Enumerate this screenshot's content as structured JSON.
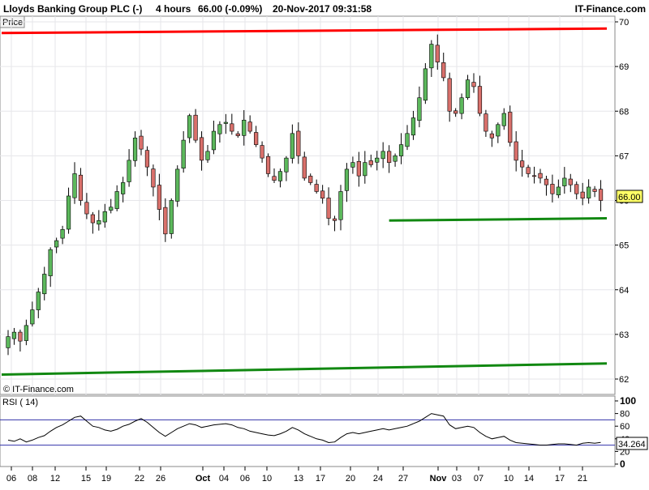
{
  "header": {
    "instrument": "Lloyds Banking Group PLC (-)",
    "timeframe": "4 hours",
    "quote": "66.00 (-0.09%)",
    "datetime": "20-Nov-2017 09:31:58",
    "brand": "IT-Finance.com"
  },
  "price_panel": {
    "label": "Price",
    "watermark": "© IT-Finance.com",
    "last_price_label": "66.00"
  },
  "rsi_panel": {
    "label": "RSI ( 14)",
    "value_label": "34.264"
  },
  "colors": {
    "up_candle": "#5cb85c",
    "down_candle": "#d9706b",
    "resistance_line": "#ff0000",
    "support_line": "#118811",
    "rsi_line": "#000000",
    "rsi_levels": "#3333aa",
    "grid": "#e6e6ea"
  },
  "chart_data": [
    {
      "type": "candlestick",
      "title": "Lloyds Banking Group PLC (-) 4 hours",
      "ylabel": "Price",
      "ylim": [
        62,
        70
      ],
      "y_ticks": [
        "70",
        "69",
        "68",
        "67",
        "66",
        "65",
        "64",
        "63",
        "62"
      ],
      "x_ticks": [
        "06",
        "08",
        "12",
        "15",
        "19",
        "22",
        "26",
        "Oct",
        "04",
        "06",
        "10",
        "13",
        "17",
        "20",
        "24",
        "27",
        "Nov",
        "03",
        "07",
        "10",
        "14",
        "17",
        "21"
      ],
      "grid": true,
      "close_series": [
        62.95,
        63.05,
        62.85,
        63.2,
        63.55,
        63.95,
        64.35,
        64.9,
        65.1,
        65.35,
        66.1,
        66.6,
        66.0,
        65.7,
        65.5,
        65.55,
        65.75,
        65.85,
        66.2,
        66.4,
        66.9,
        67.4,
        67.15,
        66.75,
        66.3,
        65.8,
        65.25,
        66.0,
        66.7,
        67.35,
        67.9,
        67.35,
        66.9,
        67.1,
        67.55,
        67.7,
        67.75,
        67.55,
        67.45,
        67.8,
        67.55,
        67.25,
        66.95,
        66.6,
        66.45,
        66.65,
        66.95,
        67.5,
        67.0,
        66.5,
        66.4,
        66.2,
        66.05,
        65.6,
        65.55,
        66.2,
        66.7,
        66.85,
        66.55,
        66.85,
        66.8,
        66.95,
        67.1,
        66.85,
        67.0,
        67.25,
        67.5,
        67.85,
        68.3,
        68.95,
        69.5,
        69.1,
        68.75,
        68.0,
        67.95,
        68.3,
        68.7,
        68.55,
        67.95,
        67.55,
        67.4,
        67.7,
        67.95,
        67.3,
        66.9,
        66.75,
        66.6,
        66.55,
        66.5,
        66.35,
        66.15,
        66.3,
        66.5,
        66.35,
        66.15,
        66.05,
        66.3,
        66.2,
        66.0
      ],
      "ohlc_note": "one candle per 4-hour session; candles colored green when close > open, red otherwise",
      "trendlines": [
        {
          "name": "resistance",
          "from": [
            0,
            69.75
          ],
          "to": [
            108,
            69.85
          ]
        },
        {
          "name": "upper support",
          "from": [
            63,
            65.55
          ],
          "to": [
            108,
            65.6
          ]
        },
        {
          "name": "lower support",
          "from": [
            0,
            62.1
          ],
          "to": [
            108,
            62.35
          ]
        }
      ],
      "current_price": 66.0
    },
    {
      "type": "line",
      "title": "RSI ( 14)",
      "ylim": [
        0,
        100
      ],
      "y_ticks": [
        "100",
        "80",
        "60",
        "40",
        "20",
        "0"
      ],
      "levels": [
        70,
        30
      ],
      "last_value": 34.264,
      "series": [
        {
          "values": [
            38,
            36,
            40,
            35,
            38,
            42,
            45,
            52,
            58,
            62,
            68,
            74,
            76,
            68,
            60,
            58,
            54,
            52,
            55,
            60,
            63,
            68,
            72,
            66,
            58,
            50,
            44,
            50,
            56,
            60,
            64,
            62,
            58,
            60,
            62,
            63,
            64,
            62,
            58,
            56,
            52,
            50,
            48,
            46,
            45,
            48,
            52,
            58,
            54,
            48,
            44,
            40,
            38,
            34,
            35,
            42,
            48,
            50,
            48,
            50,
            52,
            54,
            56,
            54,
            56,
            58,
            60,
            64,
            68,
            74,
            80,
            78,
            76,
            62,
            56,
            58,
            60,
            58,
            50,
            44,
            40,
            42,
            44,
            38,
            34,
            33,
            32,
            31,
            30,
            30,
            31,
            32,
            32,
            31,
            30,
            33,
            34,
            33,
            34.264
          ]
        }
      ]
    }
  ]
}
